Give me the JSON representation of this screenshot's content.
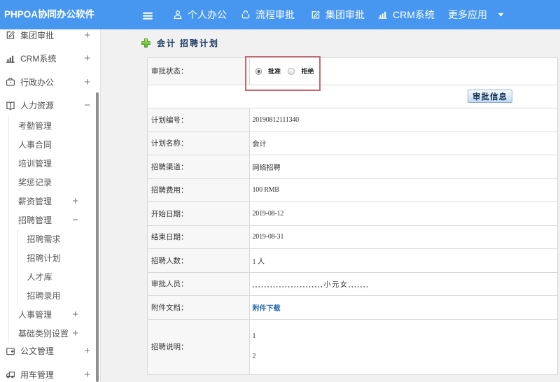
{
  "topbar": {
    "brand": "PHPOA协同办公软件",
    "nav": [
      {
        "icon": "user-icon",
        "label": "个人办公"
      },
      {
        "icon": "process-icon",
        "label": "流程审批"
      },
      {
        "icon": "edit-icon",
        "label": "集团审批"
      },
      {
        "icon": "barchart-icon",
        "label": "CRM系统"
      },
      {
        "icon": "caret-down-icon",
        "label": "更多应用"
      }
    ]
  },
  "sidebar": {
    "items": [
      {
        "icon": "edit-icon",
        "label": "集团审批",
        "toggle": "+"
      },
      {
        "icon": "barchart-icon",
        "label": "CRM系统",
        "toggle": "+"
      },
      {
        "icon": "briefcase-icon",
        "label": "行政办公",
        "toggle": "+"
      },
      {
        "icon": "book-icon",
        "label": "人力资源",
        "toggle": "-",
        "children": [
          {
            "label": "考勤管理"
          },
          {
            "label": "人事合同"
          },
          {
            "label": "培训管理"
          },
          {
            "label": "奖惩记录"
          },
          {
            "label": "薪资管理",
            "toggle": "+"
          },
          {
            "label": "招聘管理",
            "toggle": "-",
            "children": [
              {
                "label": "招聘需求"
              },
              {
                "label": "招聘计划"
              },
              {
                "label": "人才库"
              },
              {
                "label": "招聘录用"
              }
            ]
          },
          {
            "label": "人事管理",
            "toggle": "+"
          },
          {
            "label": "基础类别设置",
            "toggle": "+"
          }
        ]
      },
      {
        "icon": "document-icon",
        "label": "公文管理",
        "toggle": "+"
      },
      {
        "icon": "truck-icon",
        "label": "用车管理",
        "toggle": "+"
      }
    ]
  },
  "main": {
    "title": "会计 招聘计划",
    "approval": {
      "label": "审批状态：",
      "options": [
        {
          "label": "批准",
          "checked": true
        },
        {
          "label": "拒绝",
          "checked": false
        }
      ]
    },
    "approve_button": "审批信息",
    "fields": [
      {
        "label": "计划编号：",
        "value": "20190812111340",
        "latin": true
      },
      {
        "label": "计划名称：",
        "value": "会计"
      },
      {
        "label": "招聘渠道：",
        "value": "网络招聘"
      },
      {
        "label": "招聘费用：",
        "value": "100 RMB",
        "latin": true
      },
      {
        "label": "开始日期：",
        "value": "2019-08-12",
        "latin": true
      },
      {
        "label": "结束日期：",
        "value": "2019-08-31",
        "latin": true
      },
      {
        "label": "招聘人数：",
        "value": "1 人"
      },
      {
        "label": "审批人员：",
        "value": ",,,,,,,,,,,,,,,,,,,,,,,,小元女,,,,,,,",
        "commas": true
      },
      {
        "label": "附件文档：",
        "value": "附件下载",
        "link": true
      },
      {
        "label": "招聘说明：",
        "lines": [
          "1",
          "2"
        ]
      }
    ]
  },
  "colors": {
    "topbar": "#4797f0",
    "main_bg": "#f1f1f1",
    "table_border": "#d9d9d9",
    "label_cell_bg": "#f7f7f7",
    "title_text": "#1e3c64",
    "link": "#2a6cb5",
    "highlight_box": "#c26a71",
    "plus_icon_green": "#4ab44e"
  }
}
